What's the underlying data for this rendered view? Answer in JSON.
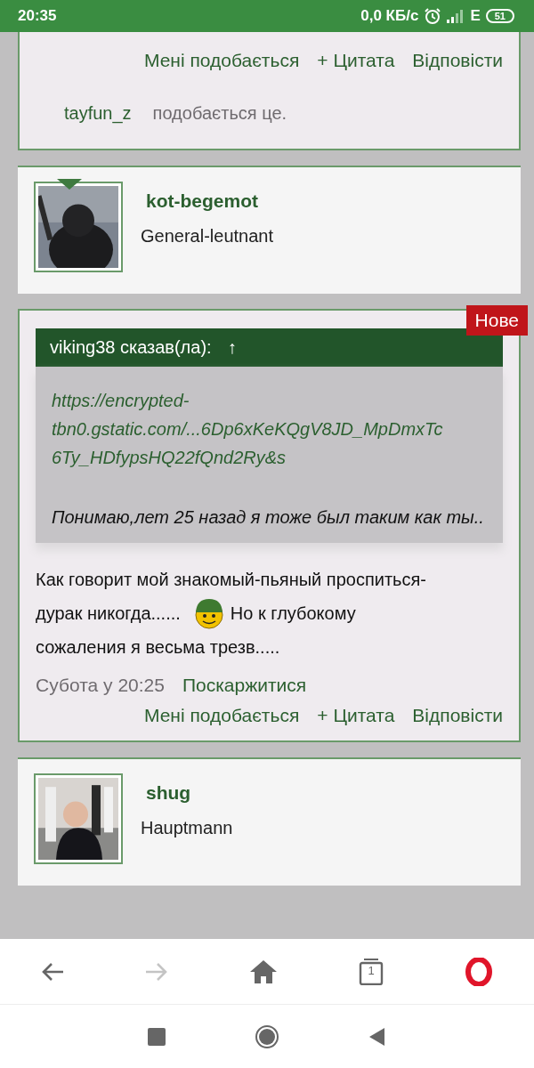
{
  "status_bar": {
    "time": "20:35",
    "speed": "0,0 КБ/с",
    "network": "E",
    "battery": "51"
  },
  "posts": [
    {
      "kind": "tail",
      "actions": [
        "Мені подобається",
        "+ Цитата",
        "Відповісти"
      ],
      "likes": {
        "user": "tayfun_z",
        "text": "подобається це."
      }
    },
    {
      "kind": "profile",
      "name": "kot-begemot",
      "rank": "General-leutnant",
      "marker": true
    },
    {
      "kind": "post",
      "badge": "Нове",
      "quote": {
        "header": "viking38 сказав(ла):",
        "arrow": "↑",
        "link": [
          "https://encrypted-",
          "tbn0.gstatic.com/...6Dp6xKeKQgV8JD_MpDmxTc",
          "6Ty_HDfypsHQ22fQnd2Ry&s"
        ],
        "text": "Понимаю,лет  25 назад я тоже  был таким как ты.."
      },
      "body": [
        [
          {
            "kind": "text",
            "text": "Как говорит мой знакомый-пьяный  проспиться-"
          }
        ],
        [
          {
            "kind": "text",
            "text": "дурак никогда......"
          },
          {
            "kind": "emoji"
          },
          {
            "kind": "text",
            "text": "Но к глубокому"
          }
        ],
        [
          {
            "kind": "text",
            "text": "сожаления я весьма трезв....."
          }
        ]
      ],
      "date": "Субота у 20:25",
      "report": "Поскаржитися",
      "actions": [
        "Мені подобається",
        "+ Цитата",
        "Відповісти"
      ]
    },
    {
      "kind": "profile",
      "name": "shug",
      "rank": "Hauptmann",
      "marker": false
    }
  ],
  "browser_bar": {
    "forward_disabled": true,
    "tab_count": "1"
  }
}
